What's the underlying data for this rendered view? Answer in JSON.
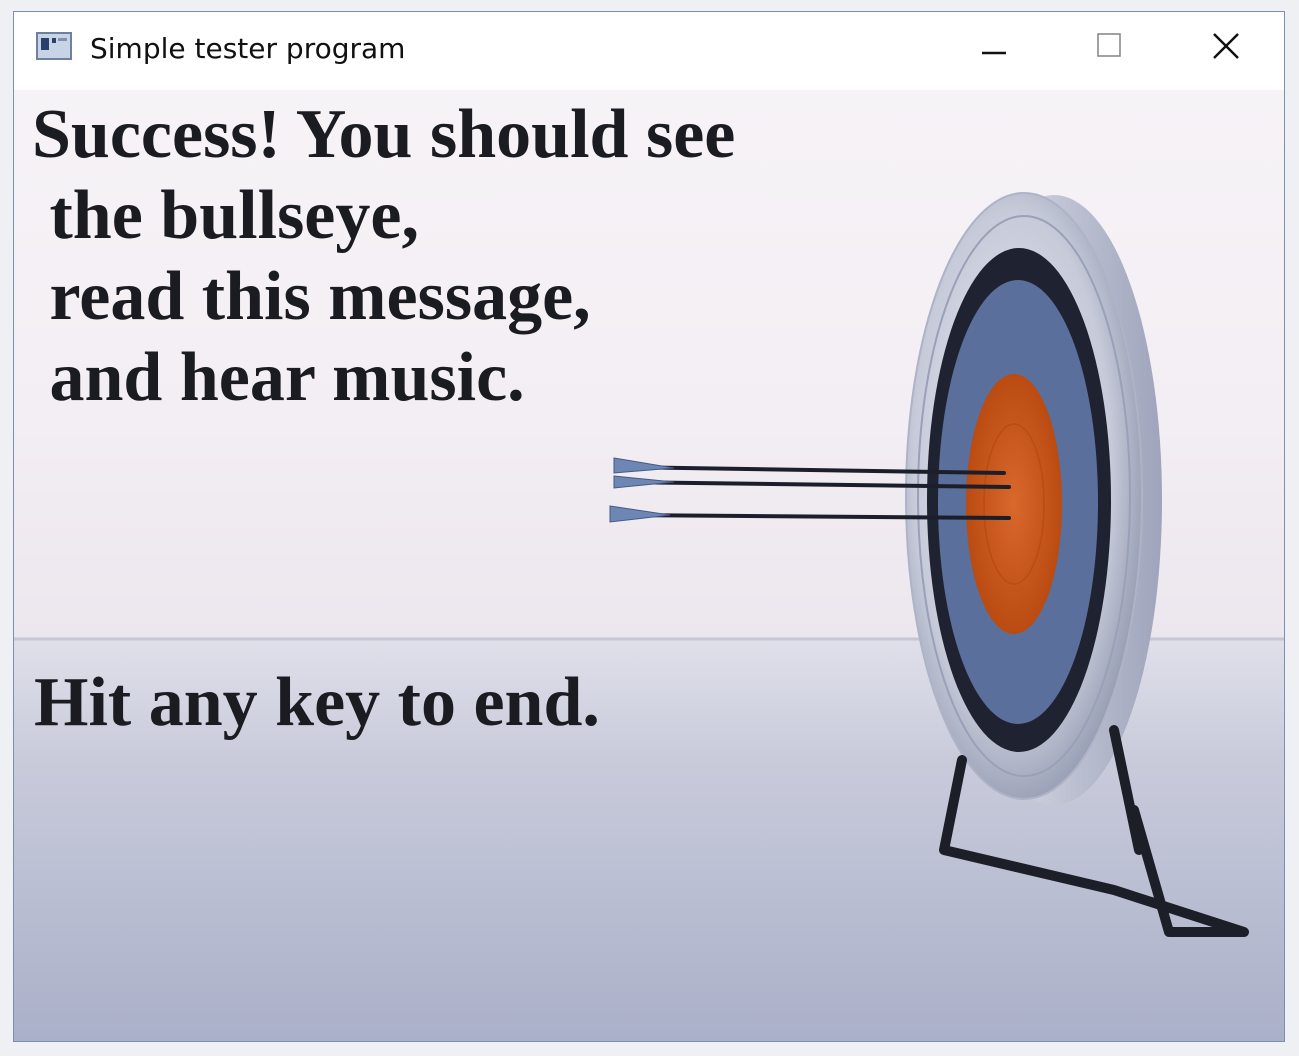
{
  "window": {
    "title": "Simple tester program",
    "app_icon": "app-window-icon",
    "controls": {
      "minimize_icon": "minimize-icon",
      "maximize_icon": "maximize-icon",
      "close_icon": "close-icon"
    }
  },
  "content": {
    "line1": "Success! You should see",
    "line2": " the bullseye,",
    "line3": " read this message,",
    "line4": " and hear music.",
    "end_prompt": "Hit any key to end."
  },
  "colors": {
    "target_center": "#c4521a",
    "target_blue_ring": "#5a6f9c",
    "target_dark_ring": "#1f2230",
    "text": "#1b1b22"
  }
}
